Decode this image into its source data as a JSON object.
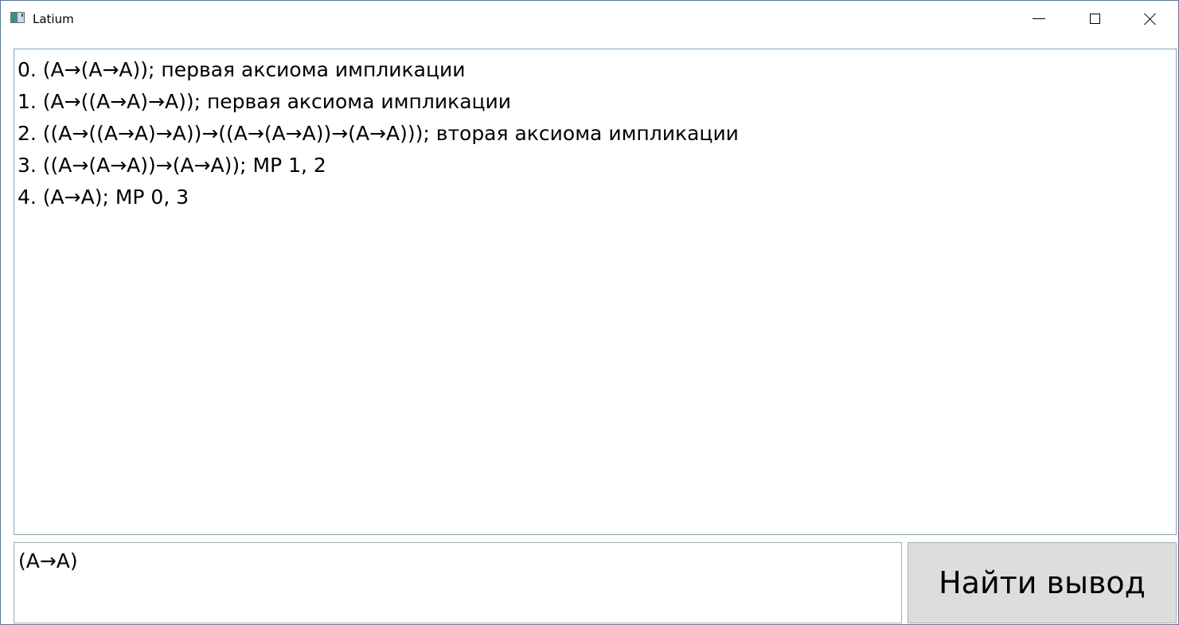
{
  "window": {
    "title": "Latium",
    "icon": "app-window-icon",
    "controls": {
      "minimize_icon": "minimize-icon",
      "maximize_icon": "maximize-icon",
      "close_icon": "close-icon"
    }
  },
  "output": {
    "lines": [
      "0. (A→(A→A)); первая аксиома импликации",
      "1. (A→((A→A)→A)); первая аксиома импликации",
      "2. ((A→((A→A)→A))→((A→(A→A))→(A→A))); вторая аксиома импликации",
      "3. ((A→(A→A))→(A→A)); MP 1, 2",
      "4. (A→A); MP 0, 3"
    ]
  },
  "input": {
    "value": "(A→A)"
  },
  "find_button": {
    "label": "Найти вывод"
  },
  "colors": {
    "window_border": "#3c7fb1",
    "output_border": "#7aa7c7",
    "button_bg": "#dddddd"
  }
}
